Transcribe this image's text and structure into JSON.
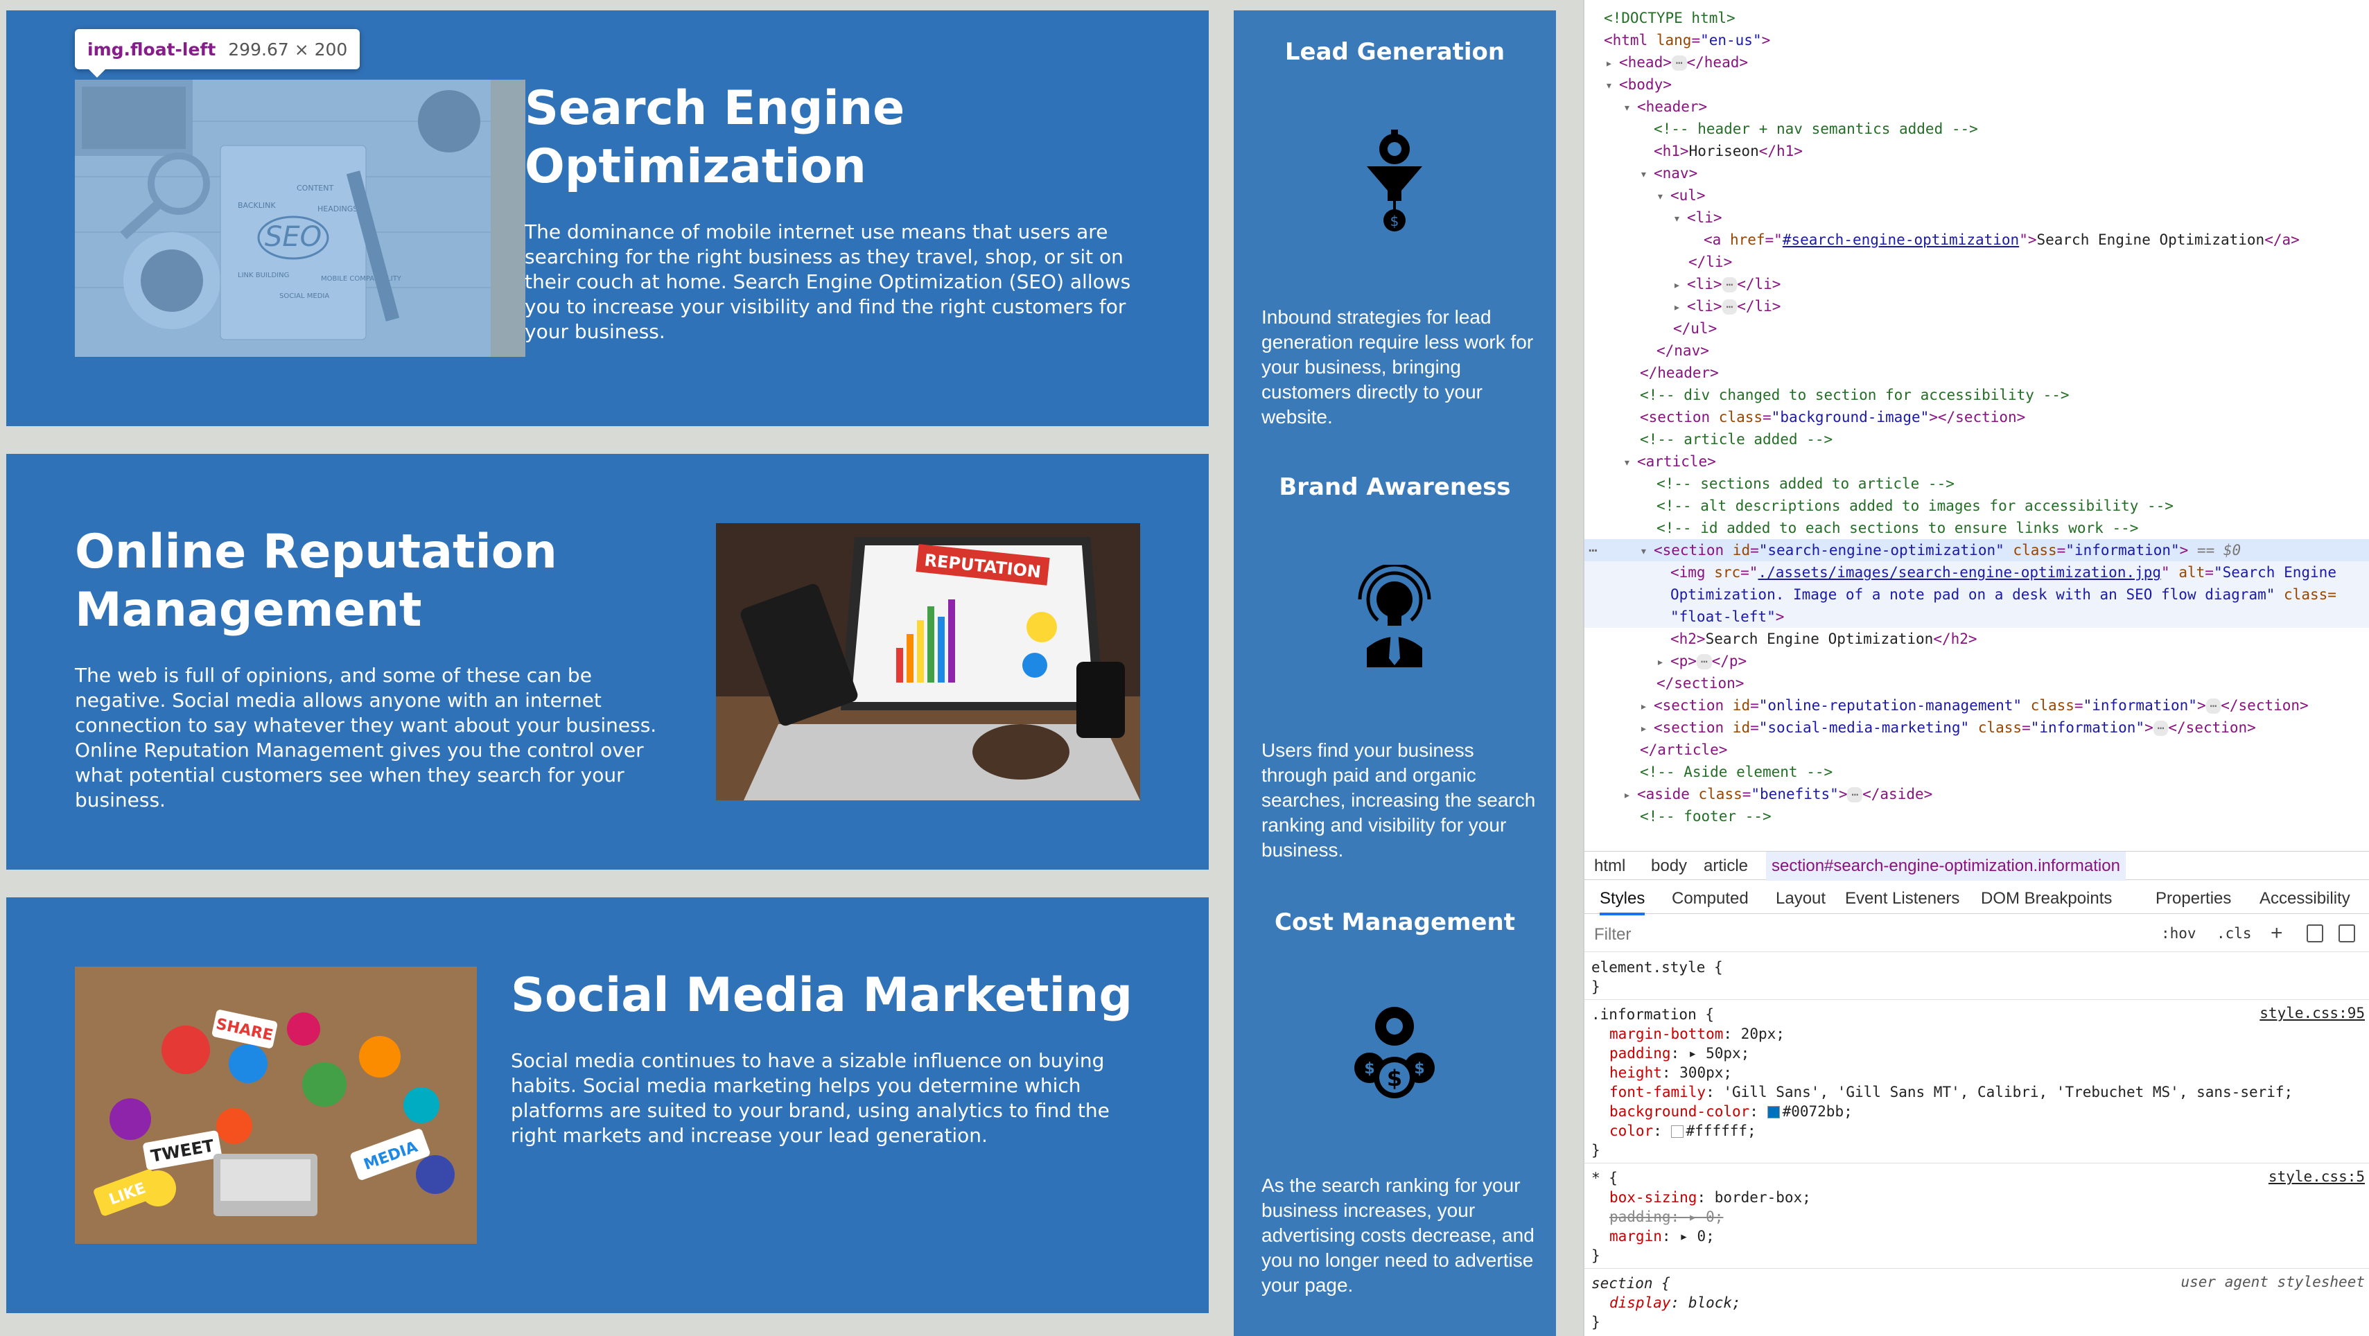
{
  "colors": {
    "info_bg": "#3072b8",
    "aside_bg": "#3a7ab9",
    "page_bg": "#d8dbd5",
    "text_white": "#ffffff",
    "swatch_blue": "#0072bb"
  },
  "tooltip": {
    "selector": "img.float-left",
    "dims": "299.67 × 200"
  },
  "sections": {
    "seo": {
      "title": "Search Engine Optimization",
      "body": "The dominance of mobile internet use means that users are searching for the right business as they travel, shop, or sit on their couch at home. Search Engine Optimization (SEO) allows you to increase your visibility and find the right customers for your business.",
      "image_labels": [
        "SEO",
        "CONTENT",
        "BACKLINK",
        "HEADINGS",
        "LINK BUILDING",
        "MOBILE COMPATIBILITY",
        "SOCIAL MEDIA"
      ]
    },
    "orm": {
      "title": "Online Reputation Management",
      "body": "The web is full of opinions, and some of these can be negative. Social media allows anyone with an internet connection to say whatever they want about your business. Online Reputation Management gives you the control over what potential customers see when they search for your business.",
      "image_label": "REPUTATION"
    },
    "smm": {
      "title": "Social Media Marketing",
      "body": "Social media continues to have a sizable influence on buying habits. Social media marketing helps you determine which platforms are suited to your brand, using analytics to find the right markets and increase your lead generation.",
      "image_labels": [
        "SHARE",
        "TWEET",
        "LIKE",
        "MEDIA"
      ]
    }
  },
  "aside": {
    "items": [
      {
        "title": "Lead Generation",
        "icon": "lead-funnel-icon",
        "text": "Inbound strategies for lead generation require less work for your business, bringing customers directly to your website."
      },
      {
        "title": "Brand Awareness",
        "icon": "brand-bulb-icon",
        "text": "Users find your business through paid and organic searches, increasing the search ranking and visibility for your business."
      },
      {
        "title": "Cost Management",
        "icon": "cost-coins-icon",
        "text": "As the search ranking for your business increases, your advertising costs decrease, and you no longer need to advertise your page."
      }
    ]
  },
  "devtools": {
    "dom": {
      "doctype": "<!DOCTYPE html>",
      "html_open_a": "<html ",
      "html_lang_attr": "lang",
      "html_lang_val": "\"en-us\"",
      "html_open_b": ">",
      "head_a": "<head>",
      "head_b": "</head>",
      "body": "<body>",
      "header": "<header>",
      "cm_header": "<!-- header + nav semantics added -->",
      "h1_a": "<h1>",
      "h1_text": "Horiseon",
      "h1_b": "</h1>",
      "nav": "<nav>",
      "ul": "<ul>",
      "li": "<li>",
      "a_open": "<a ",
      "a_href_attr": "href",
      "a_href_val": "#search-engine-optimization",
      "a_text": "Search Engine Optimization",
      "a_close": "</a>",
      "li_close": "</li>",
      "li_collapsed_a": "<li>",
      "li_collapsed_b": "</li>",
      "ul_close": "</ul>",
      "nav_close": "</nav>",
      "header_close": "</header>",
      "cm_div": "<!-- div changed to section for accessibility -->",
      "section_bg_a": "<section ",
      "class_attr": "class",
      "section_bg_val": "\"background-image\"",
      "section_bg_b": "></section>",
      "cm_article": "<!-- article added  -->",
      "article": "<article>",
      "cm_sections": "<!-- sections added to article -->",
      "cm_alt": "<!-- alt descriptions added to images for accessibility  -->",
      "cm_id": "<!-- id added to each sections to ensure links work  -->",
      "sec_open": "<section ",
      "id_attr": "id",
      "sec_seo_id": "\"search-engine-optimization\"",
      "sec_class_val": "\"information\"",
      "sec_gt": ">",
      "sel_marker": "== $0",
      "img_open": "<img ",
      "src_attr": "src",
      "img_src": "./assets/images/search-engine-optimization.jpg",
      "alt_attr": "alt",
      "img_alt_1": "\"Search Engine",
      "img_alt_2": "Optimization. Image of a note pad on a desk with an SEO flow diagram\"",
      "img_class_attr": "class=",
      "img_class_val": "\"float-left\"",
      "img_gt": ">",
      "h2_a": "<h2>",
      "h2_text": "Search Engine Optimization",
      "h2_b": "</h2>",
      "p_a": "<p>",
      "p_b": "</p>",
      "sec_close": "</section>",
      "sec_orm_id": "\"online-reputation-management\"",
      "sec_smm_id": "\"social-media-marketing\"",
      "sec_collapsed_close": "</section>",
      "article_close": "</article>",
      "cm_aside": "<!-- Aside element  -->",
      "aside_open": "<aside ",
      "aside_class_val": "\"benefits\"",
      "aside_close": "</aside>",
      "cm_footer": "<!-- footer -->",
      "ellipsis": "⋯",
      "row_dots": "⋯"
    },
    "breadcrumbs": [
      "html",
      "body",
      "article",
      "section#search-engine-optimization.information"
    ],
    "tabs": [
      "Styles",
      "Computed",
      "Layout",
      "Event Listeners",
      "DOM Breakpoints",
      "Properties",
      "Accessibility"
    ],
    "filter_placeholder": "Filter",
    "hov": ":hov",
    "cls": ".cls",
    "plus": "+",
    "rules": {
      "element_style": "element.style {",
      "brace_close": "}",
      "information_selector": ".information {",
      "information_src": "style.css:95",
      "information_props": [
        {
          "name": "margin-bottom",
          "value": "20px;"
        },
        {
          "name": "padding",
          "value": "▸ 50px;"
        },
        {
          "name": "height",
          "value": "300px;"
        },
        {
          "name": "font-family",
          "value": "'Gill Sans', 'Gill Sans MT', Calibri, 'Trebuchet MS', sans-serif;"
        },
        {
          "name": "background-color",
          "value": "#0072bb;"
        },
        {
          "name": "color",
          "value": "#ffffff;"
        }
      ],
      "star_selector": "* {",
      "star_src": "style.css:5",
      "star_props": [
        {
          "name": "box-sizing",
          "value": "border-box;"
        },
        {
          "name": "padding",
          "value": "▸ 0;"
        },
        {
          "name": "margin",
          "value": "▸ 0;"
        }
      ],
      "section_selector": "section {",
      "section_src": "user agent stylesheet",
      "section_prop": {
        "name": "display",
        "value": "block;"
      }
    }
  }
}
